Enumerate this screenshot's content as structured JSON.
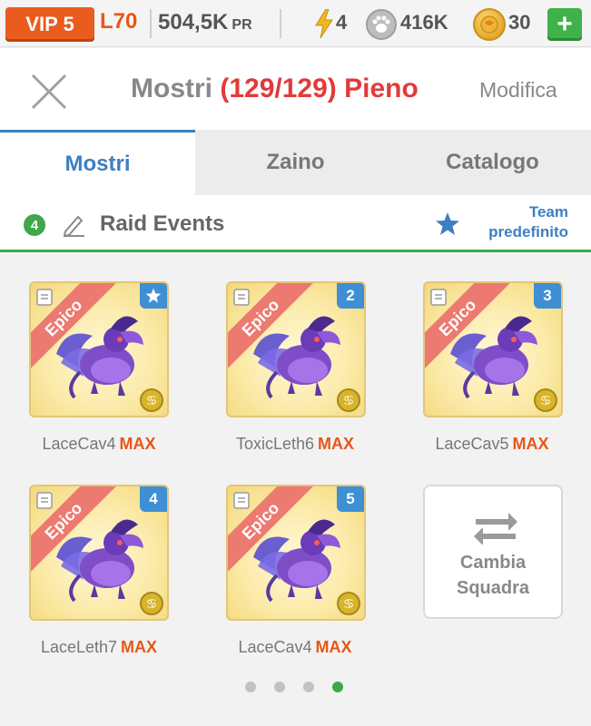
{
  "topbar": {
    "vip": "VIP 5",
    "level": "L70",
    "power_value": "504,5K",
    "power_unit": "PR",
    "energy": "4",
    "food": "416K",
    "coins": "30",
    "plus": "+"
  },
  "header": {
    "title_prefix": "Mostri",
    "title_count": "(129/129) Pieno",
    "edit": "Modifica"
  },
  "tabs": [
    {
      "label": "Mostri",
      "active": true
    },
    {
      "label": "Zaino",
      "active": false
    },
    {
      "label": "Catalogo",
      "active": false
    }
  ],
  "team": {
    "badge": "4",
    "name": "Raid Events",
    "default_line1": "Team",
    "default_line2": "predefinito"
  },
  "monsters": [
    {
      "rarity": "Epico",
      "slot": "",
      "name": "LaceCav4",
      "level": "MAX"
    },
    {
      "rarity": "Epico",
      "slot": "2",
      "name": "ToxicLeth6",
      "level": "MAX"
    },
    {
      "rarity": "Epico",
      "slot": "3",
      "name": "LaceCav5",
      "level": "MAX"
    },
    {
      "rarity": "Epico",
      "slot": "4",
      "name": "LaceLeth7",
      "level": "MAX"
    },
    {
      "rarity": "Epico",
      "slot": "5",
      "name": "LaceCav4",
      "level": "MAX"
    }
  ],
  "swap": {
    "line1": "Cambia",
    "line2": "Squadra"
  },
  "pagination": {
    "pages": 4,
    "current": 4
  },
  "colors": {
    "accent_blue": "#3d7fc1",
    "accent_green": "#3fa84a",
    "vip_orange": "#ea5b1e",
    "warning_red": "#e23a3a"
  }
}
